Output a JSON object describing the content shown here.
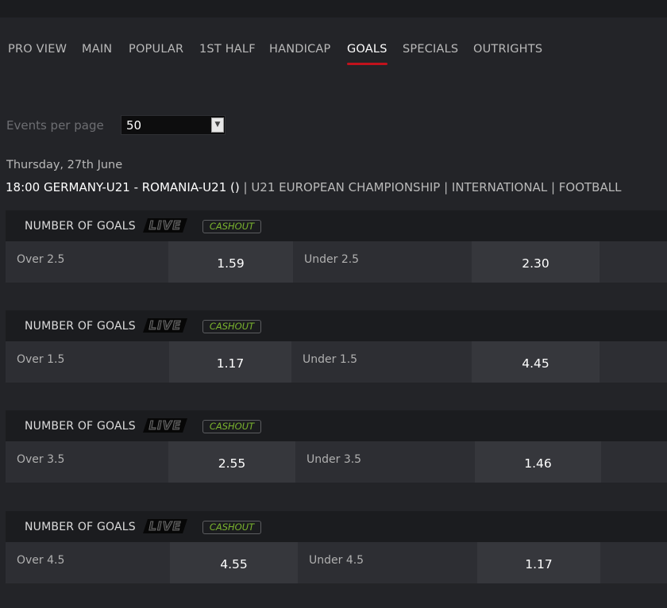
{
  "tabs": [
    {
      "label": "PRO VIEW"
    },
    {
      "label": "MAIN"
    },
    {
      "label": "POPULAR"
    },
    {
      "label": "1ST HALF"
    },
    {
      "label": "HANDICAP"
    },
    {
      "label": "GOALS",
      "active": true
    },
    {
      "label": "SPECIALS"
    },
    {
      "label": "OUTRIGHTS"
    }
  ],
  "events_per_page": {
    "label": "Events per page",
    "value": "50"
  },
  "date": "Thursday, 27th June",
  "event": {
    "match": "18:00 GERMANY-U21 - ROMANIA-U21 ()",
    "separator": " | ",
    "competition": "U21 EUROPEAN CHAMPIONSHIP",
    "region": "INTERNATIONAL",
    "sport": "FOOTBALL"
  },
  "markets": [
    {
      "title": "NUMBER OF GOALS",
      "live": "LIVE",
      "cashout": "CASHOUT",
      "over_label": "Over 2.5",
      "over_odds": "1.59",
      "under_label": "Under 2.5",
      "under_odds": "2.30"
    },
    {
      "title": "NUMBER OF GOALS",
      "live": "LIVE",
      "cashout": "CASHOUT",
      "over_label": "Over 1.5",
      "over_odds": "1.17",
      "under_label": "Under 1.5",
      "under_odds": "4.45"
    },
    {
      "title": "NUMBER OF GOALS",
      "live": "LIVE",
      "cashout": "CASHOUT",
      "over_label": "Over 3.5",
      "over_odds": "2.55",
      "under_label": "Under 3.5",
      "under_odds": "1.46"
    },
    {
      "title": "NUMBER OF GOALS",
      "live": "LIVE",
      "cashout": "CASHOUT",
      "over_label": "Over 4.5",
      "over_odds": "4.55",
      "under_label": "Under 4.5",
      "under_odds": "1.17"
    }
  ],
  "colors": {
    "accent": "#c1121c",
    "cashout": "#7ab32e",
    "background": "#232428"
  }
}
